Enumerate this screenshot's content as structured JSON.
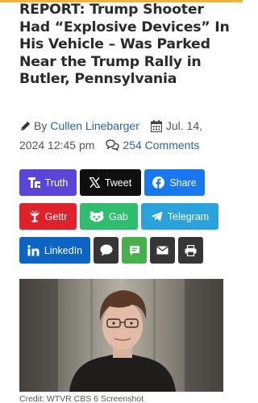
{
  "article": {
    "headline": "REPORT: Trump Shooter Had “Explosive Devices” In His Vehicle – Was Parked Near the Trump Rally in Butler, Pennsylvania",
    "by_label": "By",
    "author": "Cullen Linebarger",
    "date": "Jul. 14,",
    "time": "2024 12:45 pm",
    "comments": "254 Comments",
    "image_credit": "Credit: WTVR CBS 6 Screenshot"
  },
  "share": {
    "truth": "Truth",
    "tweet": "Tweet",
    "share": "Share",
    "gettr": "Gettr",
    "gab": "Gab",
    "telegram": "Telegram",
    "linkedin": "LinkedIn"
  },
  "icons": [
    "pencil-icon",
    "calendar-icon",
    "comments-icon",
    "truth-social-icon",
    "x-icon",
    "facebook-icon",
    "gettr-icon",
    "gab-icon",
    "telegram-icon",
    "linkedin-icon",
    "sms-icon",
    "chat-icon",
    "mail-icon",
    "print-icon"
  ],
  "colors": {
    "link": "#2b63ad",
    "truth": "#5b45d9",
    "tweet": "#0f0f0f",
    "facebook": "#1877f2",
    "gettr": "#e0202a",
    "gab": "#2fbe6d",
    "telegram": "#2aa3dd",
    "linkedin": "#0a66c2",
    "chat_green": "#48b04a",
    "dark_buttons": "#363636"
  }
}
